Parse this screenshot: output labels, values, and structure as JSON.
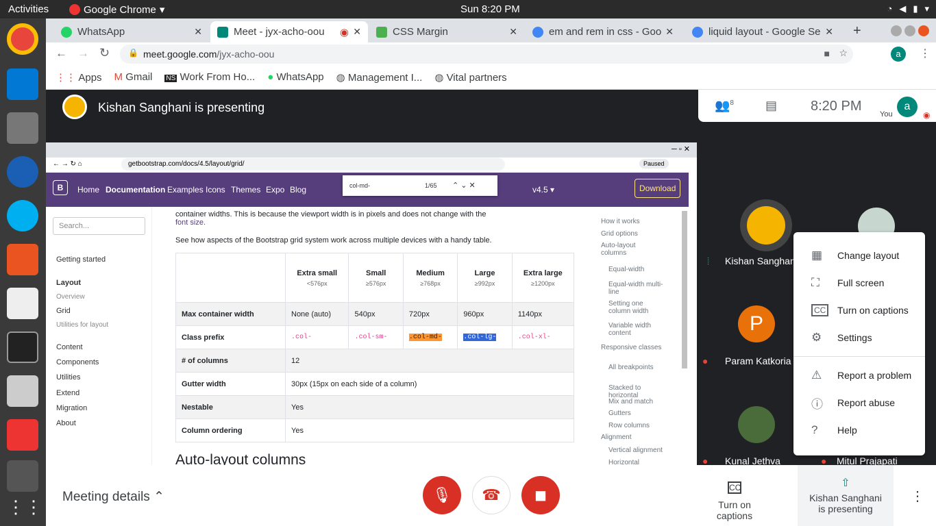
{
  "topbar": {
    "activities": "Activities",
    "app": "Google Chrome",
    "clock": "Sun  8:20 PM"
  },
  "chrome": {
    "tabs": [
      "WhatsApp",
      "Meet - jyx-acho-oou",
      "CSS Margin",
      "em and rem in css - Goog",
      "liquid layout - Google Se"
    ],
    "url_domain": "meet.google.com",
    "url_path": "/jyx-acho-oou",
    "profile": "a",
    "bookmarks": [
      "Apps",
      "Gmail",
      "Work From Ho...",
      "WhatsApp",
      "Management I...",
      "Vital partners"
    ]
  },
  "meet": {
    "presenting": "Kishan Sanghani is presenting",
    "people_count": "8",
    "time": "8:20 PM",
    "you": "You",
    "avatar_letter": "a",
    "participants": [
      {
        "name": "Kishan Sanghani"
      },
      {
        "name": "Param Katkoria",
        "letter": "P"
      },
      {
        "name": "Kunal Jethva"
      },
      {
        "name": "Mitul Prajapati"
      }
    ],
    "menu": [
      "Change layout",
      "Full screen",
      "Turn on captions",
      "Settings",
      "Report a problem",
      "Report abuse",
      "Help"
    ],
    "bottom": {
      "details": "Meeting details",
      "captions": "Turn on captions",
      "presenting1": "Kishan Sanghani",
      "presenting2": "is presenting"
    }
  },
  "shared": {
    "url": "getbootstrap.com/docs/4.5/layout/grid/",
    "paused": "Paused",
    "find_query": "col-md-",
    "find_count": "1/65",
    "nav": [
      "Home",
      "Documentation",
      "Examples",
      "Icons",
      "Themes",
      "Expo",
      "Blog"
    ],
    "version": "v4.5 ▾",
    "download": "Download",
    "search_placeholder": "Search...",
    "side": [
      "Getting started",
      "Layout",
      "Overview",
      "Grid",
      "Utilities for layout",
      "Content",
      "Components",
      "Utilities",
      "Extend",
      "Migration",
      "About"
    ],
    "intro1": "container widths. This is because the viewport width is in pixels and does not change with the",
    "intro_link": "font size.",
    "intro2": "See how aspects of the Bootstrap grid system work across multiple devices with a handy table.",
    "table": {
      "headers": [
        [
          "Extra small",
          "<576px"
        ],
        [
          "Small",
          "≥576px"
        ],
        [
          "Medium",
          "≥768px"
        ],
        [
          "Large",
          "≥992px"
        ],
        [
          "Extra large",
          "≥1200px"
        ]
      ],
      "rows": [
        [
          "Max container width",
          "None (auto)",
          "540px",
          "720px",
          "960px",
          "1140px"
        ],
        [
          "Class prefix",
          ".col-",
          ".col-sm-",
          ".col-md-",
          ".col-lg-",
          ".col-xl-"
        ],
        [
          "# of columns",
          "12"
        ],
        [
          "Gutter width",
          "30px (15px on each side of a column)"
        ],
        [
          "Nestable",
          "Yes"
        ],
        [
          "Column ordering",
          "Yes"
        ]
      ]
    },
    "heading": "Auto-layout columns",
    "toc": [
      "How it works",
      "Grid options",
      "Auto-layout columns",
      "Equal-width",
      "Equal-width multi-line",
      "Setting one column width",
      "Variable width content",
      "Responsive classes",
      "All breakpoints",
      "Stacked to horizontal",
      "Mix and match",
      "Gutters",
      "Row columns",
      "Alignment",
      "Vertical alignment",
      "Horizontal alignment"
    ]
  }
}
